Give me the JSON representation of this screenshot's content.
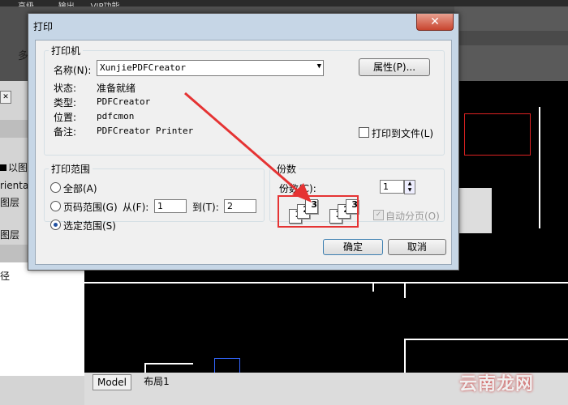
{
  "app": {
    "menubar": [
      "高级",
      "输出",
      "VIP功能"
    ],
    "ribbon_text": "多",
    "left_panel": [
      "以图",
      "rientati",
      "图层",
      "图层",
      "径"
    ],
    "tabs": [
      "Model",
      "布局1"
    ],
    "watermark": "云南龙网"
  },
  "dialog": {
    "title": "打印",
    "close_label": "✕",
    "printer": {
      "group_title": "打印机",
      "name_label": "名称(N):",
      "name_value": "XunjiePDFCreator",
      "properties_button": "属性(P)...",
      "status_label": "状态:",
      "status_value": "准备就绪",
      "type_label": "类型:",
      "type_value": "PDFCreator",
      "location_label": "位置:",
      "location_value": "pdfcmon",
      "comment_label": "备注:",
      "comment_value": "PDFCreator Printer",
      "print_to_file": "打印到文件(L)"
    },
    "range": {
      "group_title": "打印范围",
      "all": "全部(A)",
      "pages": "页码范围(G)",
      "from_label": "从(F):",
      "from_value": "1",
      "to_label": "到(T):",
      "to_value": "2",
      "selection": "选定范围(S)"
    },
    "copies": {
      "group_title": "份数",
      "count_label": "份数(C):",
      "count_value": "1",
      "collate": "自动分页(O)"
    },
    "ok_button": "确定",
    "cancel_button": "取消"
  },
  "colors": {
    "annotation": "#e53333",
    "dialog_frame": "#c6d6e6"
  }
}
